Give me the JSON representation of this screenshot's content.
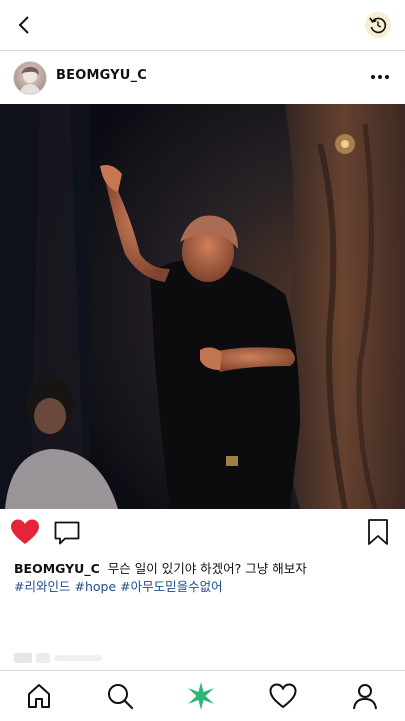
{
  "header": {
    "back_icon": "chevron-left-icon",
    "refresh_icon": "refresh-icon"
  },
  "post": {
    "username": "BEOMGYU_C",
    "more_icon": "more-horizontal-icon",
    "image_description_icon": "video-frame",
    "liked": true,
    "like_color": "#e5243b",
    "caption_username": "BEOMGYU_C",
    "caption_text": "무슨 일이 있기야 하겠어? 그냥 해보자",
    "tags": [
      "#리와인드",
      "#hope",
      "#아무도믿을수없어"
    ]
  },
  "nav": {
    "items": [
      {
        "name": "home-icon"
      },
      {
        "name": "search-icon"
      },
      {
        "name": "sparkle-icon",
        "color": "#2bb673"
      },
      {
        "name": "heart-icon"
      },
      {
        "name": "profile-icon"
      }
    ]
  },
  "colors": {
    "tag_link": "#1f4e8a",
    "divider": "#d9d9d9"
  }
}
